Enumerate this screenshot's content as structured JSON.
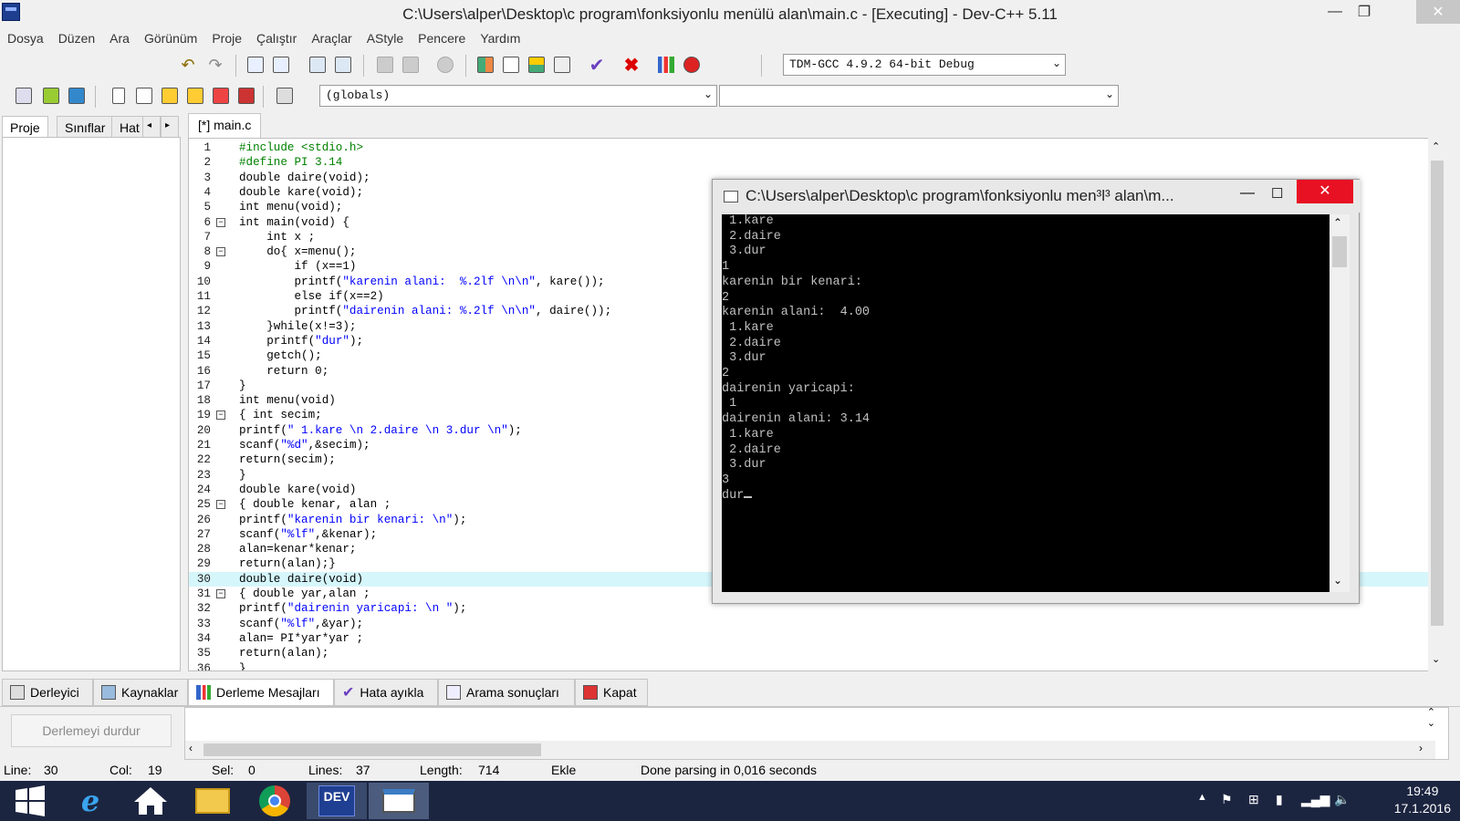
{
  "window": {
    "title": "C:\\Users\\alper\\Desktop\\c program\\fonksiyonlu menülü alan\\main.c - [Executing] - Dev-C++ 5.11",
    "minimize": "—",
    "maximize": "❐",
    "close": "✕"
  },
  "menu": [
    "Dosya",
    "Düzen",
    "Ara",
    "Görünüm",
    "Proje",
    "Çalıştır",
    "Araçlar",
    "AStyle",
    "Pencere",
    "Yardım"
  ],
  "toolbar": {
    "compiler_select": "TDM-GCC 4.9.2 64-bit Debug",
    "scope_select": "(globals)",
    "function_select": ""
  },
  "left_tabs": [
    "Proje",
    "Sınıflar",
    "Hat"
  ],
  "editor": {
    "tab_label": "[*] main.c",
    "lines": [
      "#include <stdio.h>",
      "#define PI 3.14",
      "double daire(void);",
      "double kare(void);",
      "int menu(void);",
      "int main(void) {",
      "    int x ;",
      "    do{ x=menu();",
      "        if (x==1)",
      "        printf(\"karenin alani:  %.2lf \\n\\n\", kare());",
      "        else if(x==2)",
      "        printf(\"dairenin alani: %.2lf \\n\\n\", daire());",
      "    }while(x!=3);",
      "    printf(\"dur\");",
      "    getch();",
      "    return 0;",
      "}",
      "int menu(void)",
      "{ int secim;",
      "printf(\" 1.kare \\n 2.daire \\n 3.dur \\n\");",
      "scanf(\"%d\",&secim);",
      "return(secim);",
      "}",
      "double kare(void)",
      "{ double kenar, alan ;",
      "printf(\"karenin bir kenari: \\n\");",
      "scanf(\"%lf\",&kenar);",
      "alan=kenar*kenar;",
      "return(alan);}",
      "double daire(void)",
      "{ double yar,alan ;",
      "printf(\"dairenin yaricapi: \\n \");",
      "scanf(\"%lf\",&yar);",
      "alan= PI*yar*yar ;",
      "return(alan);",
      "}"
    ]
  },
  "console": {
    "title": "C:\\Users\\alper\\Desktop\\c program\\fonksiyonlu men³l³ alan\\m...",
    "output": [
      " 1.kare",
      " 2.daire",
      " 3.dur",
      "1",
      "karenin bir kenari:",
      "2",
      "karenin alani:  4.00",
      "",
      " 1.kare",
      " 2.daire",
      " 3.dur",
      "2",
      "dairenin yaricapi:",
      " 1",
      "dairenin alani: 3.14",
      "",
      " 1.kare",
      " 2.daire",
      " 3.dur",
      "3",
      "dur"
    ]
  },
  "bottom_tabs": [
    "Derleyici",
    "Kaynaklar",
    "Derleme Mesajları",
    "Hata ayıkla",
    "Arama sonuçları",
    "Kapat"
  ],
  "stop_button": "Derlemeyi durdur",
  "status": {
    "line_label": "Line:",
    "line": "30",
    "col_label": "Col:",
    "col": "19",
    "sel_label": "Sel:",
    "sel": "0",
    "lines_label": "Lines:",
    "lines": "37",
    "length_label": "Length:",
    "length": "714",
    "mode": "Ekle",
    "message": "Done parsing in 0,016 seconds"
  },
  "taskbar": {
    "time": "19:49",
    "date": "17.1.2016",
    "dev_label": "DEV"
  },
  "colors": {
    "preprocessor": "#008000",
    "string": "#0000ff",
    "keyword": "#000000",
    "highlight": "#d5f6fb",
    "console_bg": "#000000",
    "console_close": "#e81123"
  }
}
